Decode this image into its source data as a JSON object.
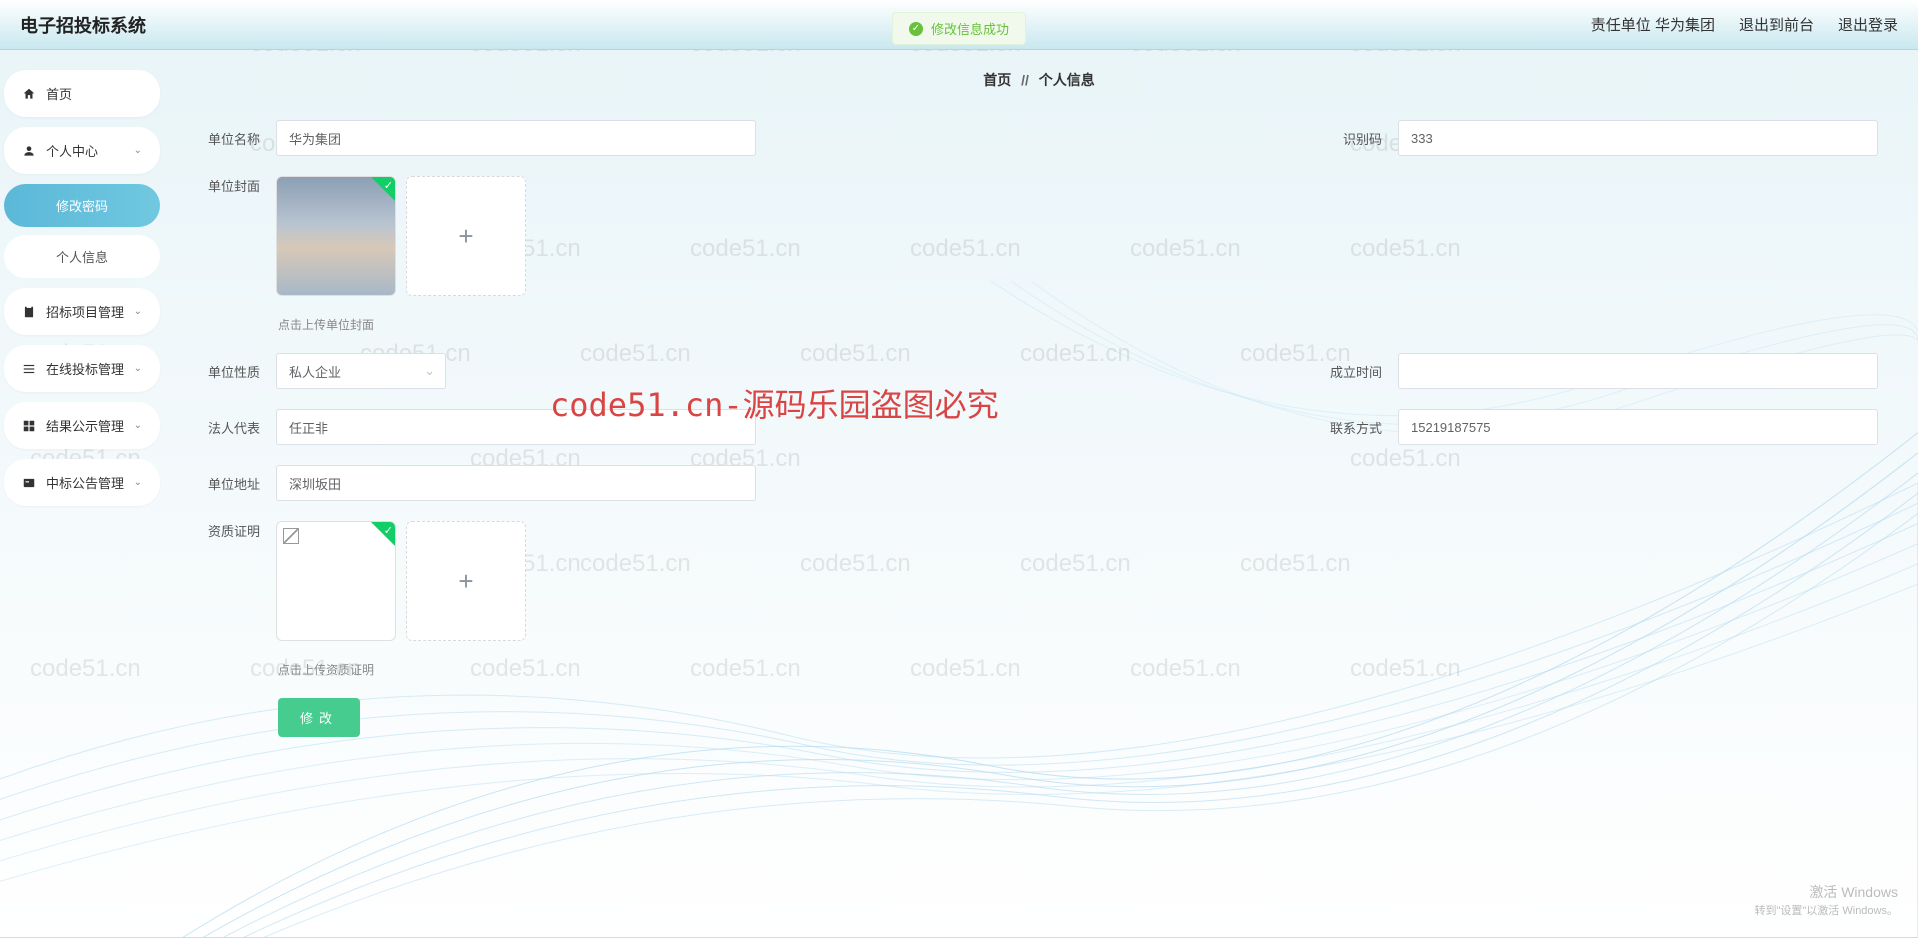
{
  "header": {
    "logo": "电子招投标系统",
    "org_label": "责任单位 华为集团",
    "exit_front": "退出到前台",
    "logout": "退出登录"
  },
  "toast": {
    "text": "修改信息成功"
  },
  "sidebar": {
    "home": "首页",
    "personal": "个人中心",
    "sub_password": "修改密码",
    "sub_info": "个人信息",
    "bid_project": "招标项目管理",
    "online_bid": "在线投标管理",
    "result": "结果公示管理",
    "winning": "中标公告管理"
  },
  "breadcrumb": {
    "home": "首页",
    "sep": "//",
    "current": "个人信息"
  },
  "form": {
    "org_name_label": "单位名称",
    "org_name_value": "华为集团",
    "id_code_label": "识别码",
    "id_code_value": "333",
    "org_cover_label": "单位封面",
    "cover_hint": "点击上传单位封面",
    "org_type_label": "单位性质",
    "org_type_value": "私人企业",
    "establish_label": "成立时间",
    "establish_value": "",
    "legal_rep_label": "法人代表",
    "legal_rep_value": "任正非",
    "contact_label": "联系方式",
    "contact_value": "15219187575",
    "address_label": "单位地址",
    "address_value": "深圳坂田",
    "qualification_label": "资质证明",
    "qualification_hint": "点击上传资质证明",
    "submit": "修改"
  },
  "watermark": {
    "text": "code51.cn",
    "red": "code51.cn-源码乐园盗图必究"
  },
  "windows": {
    "line1": "激活 Windows",
    "line2": "转到\"设置\"以激活 Windows。"
  }
}
